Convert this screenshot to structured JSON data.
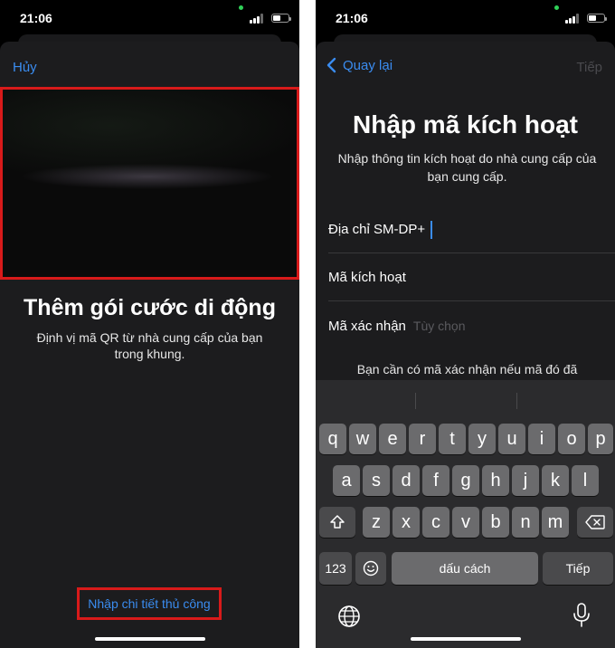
{
  "left": {
    "time": "21:06",
    "cancel_label": "Hủy",
    "title": "Thêm gói cước di động",
    "subtitle": "Định vị mã QR từ nhà cung cấp của bạn trong khung.",
    "manual_link": "Nhập chi tiết thủ công"
  },
  "right": {
    "time": "21:06",
    "back_label": "Quay lại",
    "next_label": "Tiếp",
    "title": "Nhập mã kích hoạt",
    "subtitle": "Nhập thông tin kích hoạt do nhà cung cấp của bạn cung cấp.",
    "fields": [
      {
        "label": "Địa chỉ SM-DP+",
        "placeholder": ""
      },
      {
        "label": "Mã kích hoạt",
        "placeholder": ""
      },
      {
        "label": "Mã xác nhận",
        "placeholder": "Tùy chọn"
      }
    ],
    "note": "Bạn cần có mã xác nhận nếu mã đó đã",
    "keyboard": {
      "row1": [
        "q",
        "w",
        "e",
        "r",
        "t",
        "y",
        "u",
        "i",
        "o",
        "p"
      ],
      "row2": [
        "a",
        "s",
        "d",
        "f",
        "g",
        "h",
        "j",
        "k",
        "l"
      ],
      "row3": [
        "z",
        "x",
        "c",
        "v",
        "b",
        "n",
        "m"
      ],
      "numbers_label": "123",
      "space_label": "dấu cách",
      "return_label": "Tiếp"
    }
  },
  "colors": {
    "accent": "#3a8cf0",
    "highlight": "#d81a1a",
    "sheet": "#1c1c1e"
  }
}
